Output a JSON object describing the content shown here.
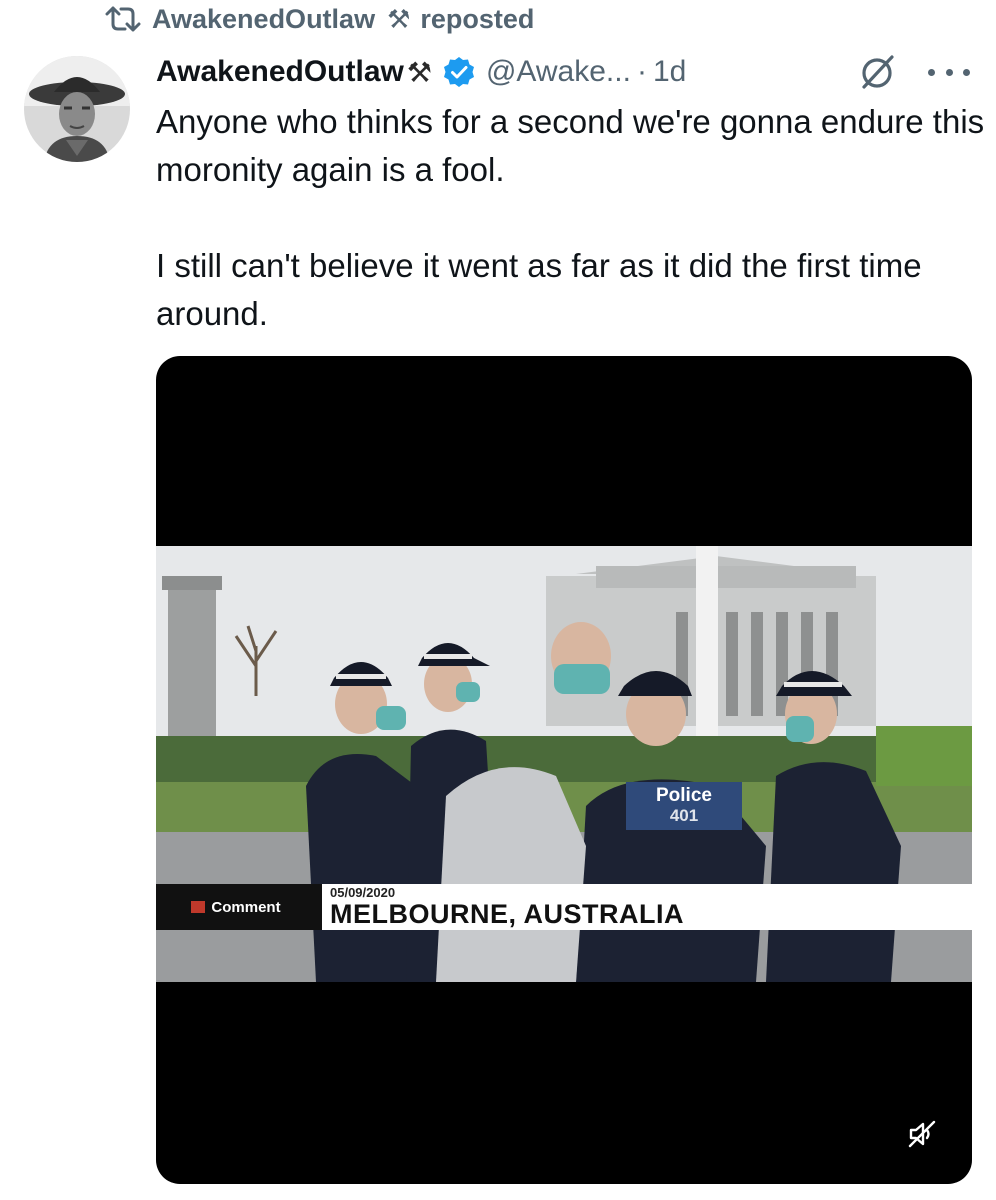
{
  "repost": {
    "user": "AwakenedOutlaw",
    "emoji": "⚒",
    "label": "reposted"
  },
  "post": {
    "author_name": "AwakenedOutlaw",
    "author_emoji": "⚒",
    "handle": "@Awake...",
    "separator": "·",
    "time": "1d",
    "paragraphs": [
      "Anyone who thinks for a second we're gonna endure this moronity again is a fool.",
      "I still can't believe it went as far as it did the first time around."
    ]
  },
  "media": {
    "brand_label": "Comment",
    "caption_date": "05/09/2020",
    "caption_place": "MELBOURNE, AUSTRALIA",
    "vest_label": "Police",
    "vest_number": "401"
  },
  "colors": {
    "text_primary": "#0f1419",
    "text_secondary": "#536471",
    "verified_blue": "#1d9bf0",
    "police_navy": "#1c2233"
  },
  "icons": {
    "repost": "repost-icon",
    "verified": "verified-badge-icon",
    "grok": "grok-icon",
    "more": "more-options-icon",
    "mute": "volume-muted-icon"
  }
}
